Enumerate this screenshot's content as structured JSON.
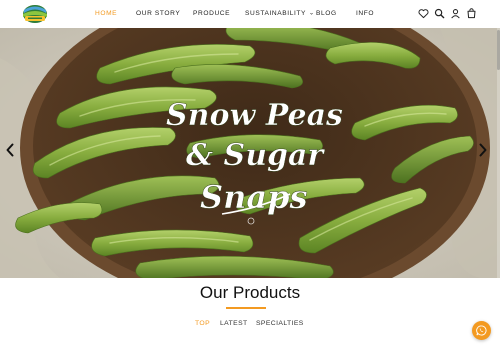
{
  "nav": {
    "items": [
      {
        "label": "HOME",
        "active": true
      },
      {
        "label": "OUR STORY",
        "active": false
      },
      {
        "label": "PRODUCE",
        "active": false
      },
      {
        "label": "SUSTAINABILITY",
        "active": false,
        "has_dropdown": true
      },
      {
        "label": "BLOG",
        "active": false
      },
      {
        "label": "INFO",
        "active": false
      }
    ],
    "icons": [
      "heart-icon",
      "search-icon",
      "user-icon",
      "cart-icon"
    ]
  },
  "hero": {
    "line1": "Snow Peas",
    "line2": "& Sugar",
    "line3": "Snaps",
    "prev_icon": "chevron-left-icon",
    "next_icon": "chevron-right-icon"
  },
  "products": {
    "title": "Our Products",
    "tabs": [
      {
        "label": "TOP",
        "active": true
      },
      {
        "label": "LATEST",
        "active": false
      },
      {
        "label": "SPECIALTIES",
        "active": false
      }
    ]
  },
  "colors": {
    "accent": "#f39a21",
    "pea_green": "#7fa83a",
    "bowl_brown": "#6b4a2e"
  },
  "floating": {
    "icon": "whatsapp-icon"
  }
}
